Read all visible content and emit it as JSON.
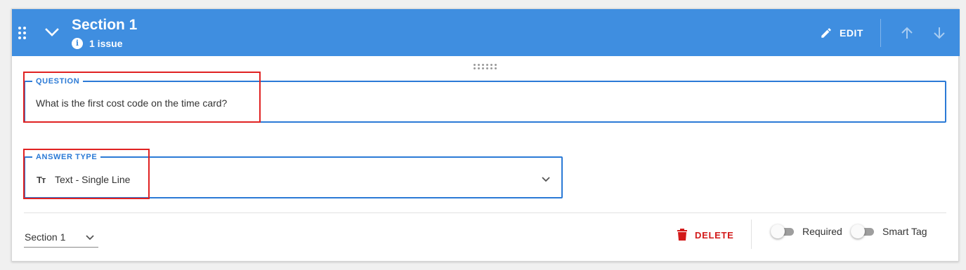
{
  "header": {
    "title": "Section 1",
    "issue_count": "1 issue",
    "edit_label": "EDIT",
    "background_color": "#3f8ee0"
  },
  "question": {
    "label": "QUESTION",
    "value": "What is the first cost code on the time card?"
  },
  "answer_type": {
    "label": "ANSWER TYPE",
    "value": "Text - Single Line",
    "icon": "text-type-icon",
    "icon_glyph": "Tт"
  },
  "footer": {
    "section_select_value": "Section 1",
    "delete_label": "DELETE",
    "toggles": [
      {
        "label": "Required",
        "checked": false
      },
      {
        "label": "Smart Tag",
        "checked": false
      }
    ]
  },
  "colors": {
    "accent": "#2b7ad6",
    "delete": "#d31a1a",
    "highlight": "#e02222"
  }
}
